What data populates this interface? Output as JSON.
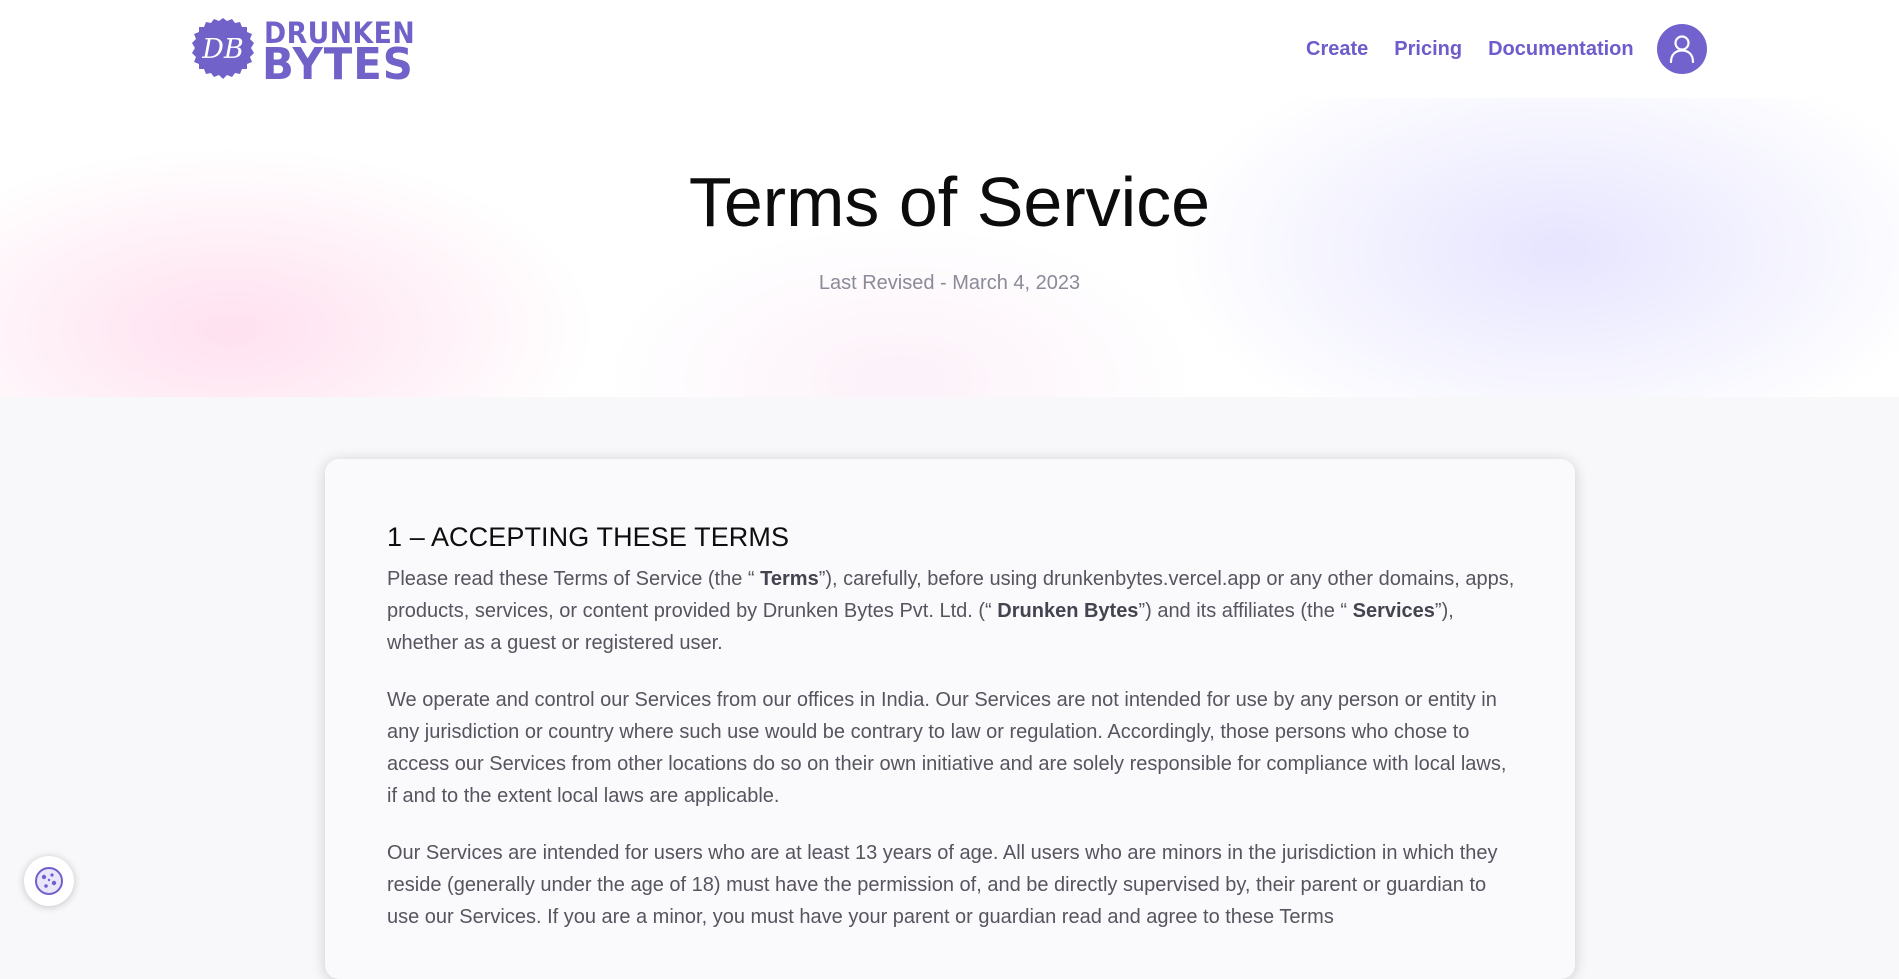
{
  "logo": {
    "badge_text": "DB",
    "name_top": "DRUNKEN",
    "name_bottom": "BYTES"
  },
  "nav": {
    "items": [
      {
        "label": "Create"
      },
      {
        "label": "Pricing"
      },
      {
        "label": "Documentation"
      }
    ],
    "avatar_icon": "user-icon"
  },
  "hero": {
    "title": "Terms of Service",
    "last_revised": "Last Revised - March 4, 2023"
  },
  "content": {
    "section1": {
      "heading": "1 – ACCEPTING THESE TERMS",
      "p1": {
        "t1": "Please read these Terms of Service (the “ ",
        "b1": "Terms",
        "t2": "”), carefully, before using drunkenbytes.vercel.app or any other domains, apps, products, services, or content provided by Drunken Bytes Pvt. Ltd. (“ ",
        "b2": "Drunken Bytes",
        "t3": "”) and its affiliates (the “ ",
        "b3": "Services",
        "t4": "”), whether as a guest or registered user."
      },
      "p2": "We operate and control our Services from our offices in India. Our Services are not intended for use by any person or entity in any jurisdiction or country where such use would be contrary to law or regulation. Accordingly, those persons who chose to access our Services from other locations do so on their own initiative and are solely responsible for compliance with local laws, if and to the extent local laws are applicable.",
      "p3": "Our Services are intended for users who are at least 13 years of age. All users who are minors in the jurisdiction in which they reside (generally under the age of 18) must have the permission of, and be directly supervised by, their parent or guardian to use our Services. If you are a minor, you must have your parent or guardian read and agree to these Terms"
    }
  },
  "cookie": {
    "icon": "cookie-icon"
  },
  "colors": {
    "brand": "#7062c9",
    "nav_link": "#6c5ccc",
    "body_text": "#55555f",
    "muted": "#8a8a98"
  }
}
